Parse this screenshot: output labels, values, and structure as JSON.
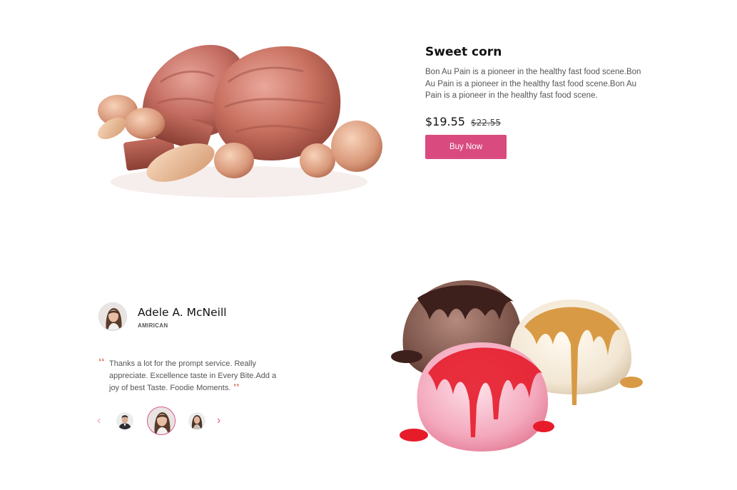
{
  "product": {
    "title": "Sweet corn",
    "description": "Bon Au Pain is a pioneer in the healthy fast food scene.Bon Au Pain is a pioneer in the healthy fast food scene.Bon Au Pain is a pioneer in the healthy fast food scene.",
    "price_current": "$19.55",
    "price_old": "$22.55",
    "buy_label": "Buy Now",
    "accent_color": "#d94b7f"
  },
  "testimonial": {
    "author_name": "Adele A. McNeill",
    "author_origin": "AMIRICAN",
    "quote": "Thanks a lot for the prompt service. Really appreciate. Excellence taste in Every Bite.Add a joy of best Taste. Foodie Moments.",
    "quote_open": "❛❛",
    "quote_close": "❜❜"
  },
  "slider": {
    "prev_icon": "‹",
    "next_icon": "›",
    "thumbs": [
      "man-portrait",
      "woman-portrait",
      "woman-portrait-2"
    ],
    "active_index": 1
  },
  "icons": {
    "quote_color": "#e0836d",
    "arrow_color": "#e35b88"
  }
}
